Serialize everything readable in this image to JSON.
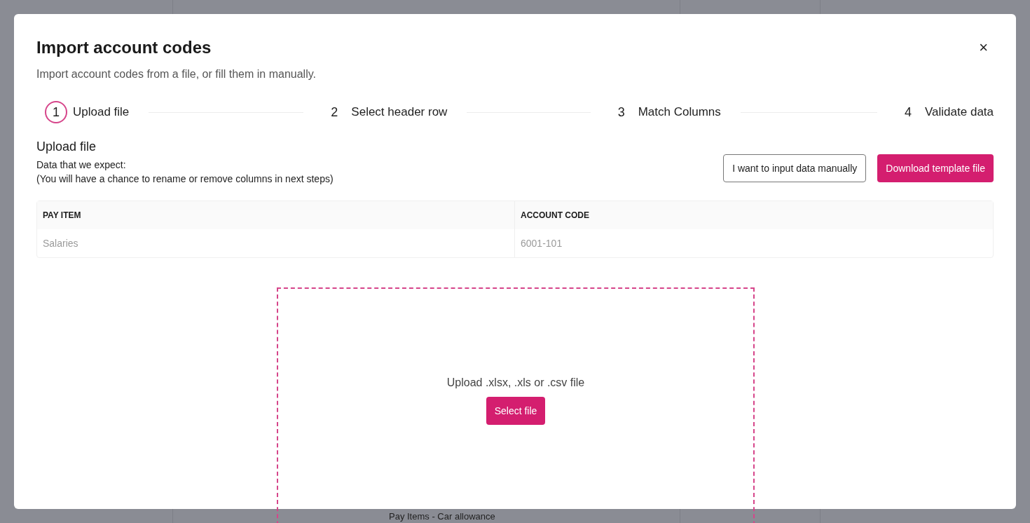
{
  "background_page": {
    "text": "Pay Items - Car allowance"
  },
  "dialog": {
    "title": "Import account codes",
    "subtitle": "Import account codes from a file, or fill them in manually.",
    "close": "×",
    "steps": [
      {
        "number": "1",
        "label": "Upload file",
        "selected": true
      },
      {
        "number": "2",
        "label": "Select header row",
        "selected": false
      },
      {
        "number": "3",
        "label": "Match Columns",
        "selected": false
      },
      {
        "number": "4",
        "label": "Validate data",
        "selected": false
      }
    ],
    "section_title": "Upload file",
    "description": [
      "Data that we expect:",
      "(You will have a chance to rename or remove columns in next steps)"
    ],
    "buttons": [
      {
        "label": "I want to input data manually",
        "kind": "secondary"
      },
      {
        "label": "Download template file",
        "kind": "primary"
      }
    ],
    "table": {
      "columns": [
        "PAY ITEM",
        "ACCOUNT CODE"
      ],
      "rows": [
        [
          "Salaries",
          "6001-101"
        ]
      ]
    },
    "dropzone": {
      "text": "Upload .xlsx, .xls or .csv file",
      "button": "Select file"
    }
  }
}
